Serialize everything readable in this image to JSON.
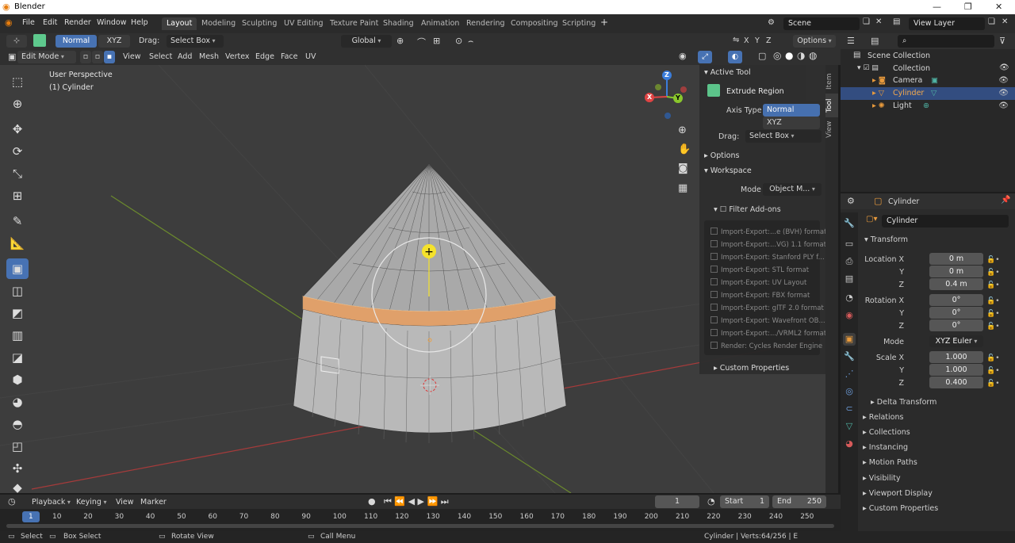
{
  "window": {
    "title": "Blender"
  },
  "menu": [
    "File",
    "Edit",
    "Render",
    "Window",
    "Help"
  ],
  "workspaces": [
    "Layout",
    "Modeling",
    "Sculpting",
    "UV Editing",
    "Texture Paint",
    "Shading",
    "Animation",
    "Rendering",
    "Compositing",
    "Scripting"
  ],
  "active_workspace": "Layout",
  "scene": "Scene",
  "view_layer": "View Layer",
  "tool_header": {
    "normal": "Normal",
    "xyz": "XYZ",
    "drag_label": "Drag:",
    "drag_value": "Select Box",
    "orientation": "Global",
    "axes": [
      "X",
      "Y",
      "Z"
    ],
    "options": "Options"
  },
  "mode_header": {
    "mode": "Edit Mode",
    "menus": [
      "View",
      "Select",
      "Add",
      "Mesh",
      "Vertex",
      "Edge",
      "Face",
      "UV"
    ]
  },
  "viewport": {
    "perspective": "User Perspective",
    "object": "(1) Cylinder",
    "gizmo_axes": {
      "x": "X",
      "y": "Y",
      "z": "Z"
    }
  },
  "colors": {
    "accent": "#4772b3",
    "selected_face": "#e0a06a",
    "x_axis": "#e04444",
    "y_axis": "#8ac72c",
    "z_axis": "#3b7ddb",
    "cursor_yellow": "#f5e22b"
  },
  "npanel": {
    "tabs": [
      "Item",
      "Tool",
      "View"
    ],
    "active_tool_title": "Active Tool",
    "tool_name": "Extrude Region",
    "axis_type_label": "Axis Type",
    "axis_options": [
      "Normal",
      "XYZ"
    ],
    "drag_label": "Drag:",
    "drag_value": "Select Box",
    "options": "Options",
    "workspace": "Workspace",
    "mode_label": "Mode",
    "mode_value": "Object M...",
    "filter_addons": "Filter Add-ons",
    "addons": [
      "Import-Export:...e (BVH) format",
      "Import-Export:...VG) 1.1 format",
      "Import-Export: Stanford PLY f...",
      "Import-Export: STL format",
      "Import-Export: UV Layout",
      "Import-Export: FBX format",
      "Import-Export: glTF 2.0 format",
      "Import-Export: Wavefront OB...",
      "Import-Export:.../VRML2 format",
      "Render: Cycles Render Engine"
    ],
    "custom_properties": "Custom Properties"
  },
  "outliner": {
    "root": "Scene Collection",
    "collection": "Collection",
    "items": [
      {
        "name": "Camera",
        "selected": false
      },
      {
        "name": "Cylinder",
        "selected": true
      },
      {
        "name": "Light",
        "selected": false
      }
    ]
  },
  "properties": {
    "object": "Cylinder",
    "datablock": "Cylinder",
    "transform": "Transform",
    "location_label": "Location X",
    "location": [
      "0 m",
      "0 m",
      "0.4 m"
    ],
    "rotation_label": "Rotation X",
    "rotation": [
      "0°",
      "0°",
      "0°"
    ],
    "mode_label": "Mode",
    "rotation_mode": "XYZ Euler",
    "scale_label": "Scale X",
    "scale": [
      "1.000",
      "1.000",
      "0.400"
    ],
    "axis_y": "Y",
    "axis_z": "Z",
    "delta": "Delta Transform",
    "sections": [
      "Relations",
      "Collections",
      "Instancing",
      "Motion Paths",
      "Visibility",
      "Viewport Display",
      "Custom Properties"
    ]
  },
  "timeline": {
    "menus": [
      "Playback",
      "Keying",
      "View",
      "Marker"
    ],
    "current_frame": "1",
    "start_label": "Start",
    "start": "1",
    "end_label": "End",
    "end": "250",
    "ticks": [
      "1",
      "10",
      "20",
      "30",
      "40",
      "50",
      "60",
      "70",
      "80",
      "90",
      "100",
      "110",
      "120",
      "130",
      "140",
      "150",
      "160",
      "170",
      "180",
      "190",
      "200",
      "210",
      "220",
      "230",
      "240",
      "250"
    ]
  },
  "status": {
    "select": "Select",
    "box_select": "Box Select",
    "rotate_view": "Rotate View",
    "call_menu": "Call Menu",
    "info": "Cylinder | Verts:64/256 | E"
  }
}
